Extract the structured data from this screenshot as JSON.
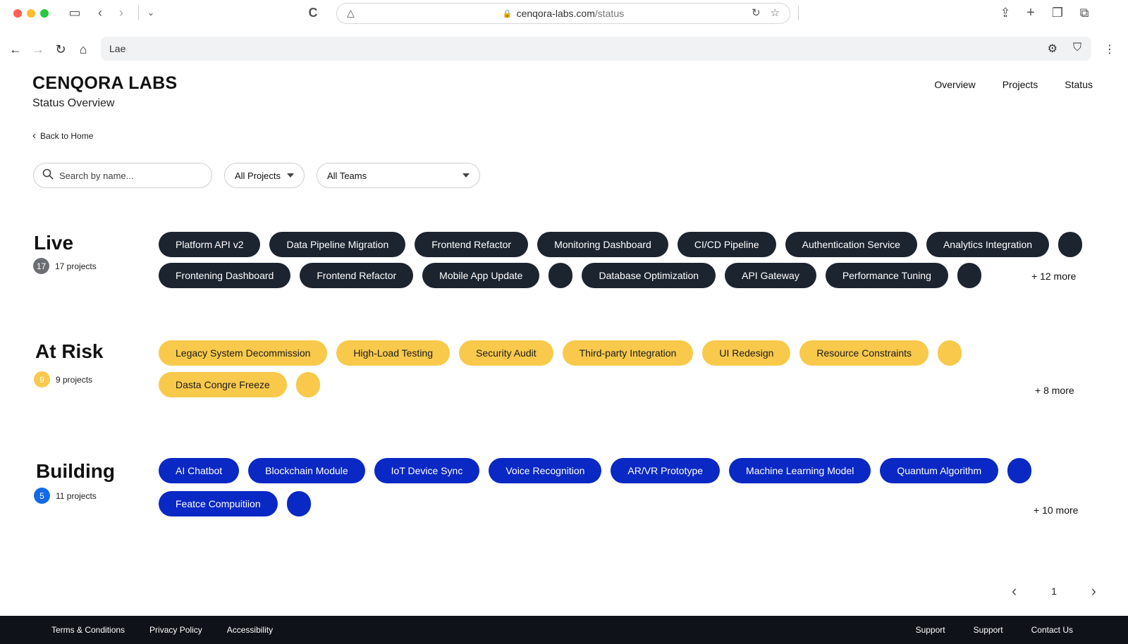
{
  "browser": {
    "url_domain": "cenqora-labs.com",
    "url_path": "/status",
    "address_text": "Lae"
  },
  "header": {
    "brand": "CENQORA LABS",
    "subtitle": "Status Overview",
    "nav": [
      "Overview",
      "Projects",
      "Status"
    ],
    "back_label": "Back to Home"
  },
  "filters": {
    "search_placeholder": "Search by name...",
    "projects_select": "All Projects",
    "teams_select": "All Teams"
  },
  "sections": [
    {
      "key": "live",
      "title": "Live",
      "badge": "17",
      "count_label": "17 projects",
      "badge_color": "#6b6f75",
      "rows": [
        [
          "Platform API v2",
          "Data Pipeline Migration",
          "Frontend Refactor",
          "Monitoring Dashboard",
          "CI/CD Pipeline",
          "Authentication Service",
          "Analytics Integration",
          ""
        ],
        [
          "Frontening Dashboard",
          "Frontend Refactor",
          "Mobile App Update",
          "",
          "Database Optimization",
          "API Gateway",
          "Performance Tuning",
          ""
        ]
      ],
      "more": "+ 12 more"
    },
    {
      "key": "at_risk",
      "title": "At Risk",
      "badge": "9",
      "count_label": "9 projects",
      "badge_color": "#f8c94b",
      "rows": [
        [
          "Legacy System Decommission",
          "High-Load Testing",
          "Security Audit",
          "Third-party Integration",
          "UI Redesign",
          "Resource Constraints",
          ""
        ],
        [
          "Dasta Congre Freeze",
          ""
        ]
      ],
      "more": "+ 8 more"
    },
    {
      "key": "building",
      "title": "Building",
      "badge": "5",
      "count_label": "11 projects",
      "badge_color": "#1469e6",
      "rows": [
        [
          "AI Chatbot",
          "Blockchain Module",
          "IoT Device Sync",
          "Voice Recognition",
          "AR/VR Prototype",
          "Machine Learning Model",
          "Quantum Algorithm",
          ""
        ],
        [
          "Featce Compuitiion",
          ""
        ]
      ],
      "more": "+ 10 more"
    }
  ],
  "pagination": {
    "page": "1"
  },
  "footer": {
    "left": [
      "Terms & Conditions",
      "Privacy Policy",
      "Accessibility"
    ],
    "right": [
      "Support",
      "Support",
      "Contact Us"
    ]
  },
  "colors": {
    "live_chip": "#1c2430",
    "risk_chip": "#f8c94b",
    "building_chip": "#0a28c4",
    "footer_bg": "#0f1218"
  }
}
